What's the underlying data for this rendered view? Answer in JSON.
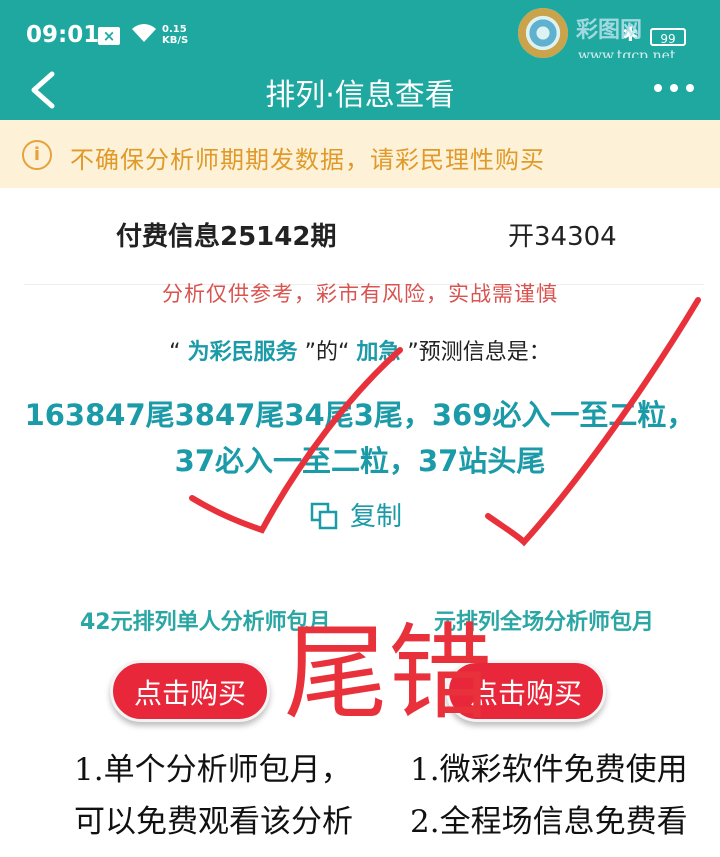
{
  "status": {
    "time": "09:01",
    "x_badge": "×",
    "speed_value": "0.15",
    "speed_unit": "KB/S",
    "battery": "99"
  },
  "watermark": {
    "title": "彩图网",
    "url": "www.tqcp.net"
  },
  "nav": {
    "title": "排列·信息查看",
    "back_icon": "chevron-left-icon",
    "more_icon": "more-dots-icon"
  },
  "notice": {
    "icon": "info-icon",
    "text": "不确保分析师期期发数据，请彩民理性购买"
  },
  "info": {
    "title": "付费信息25142期",
    "open_result": "开34304",
    "warning": "分析仅供参考，彩市有风险，实战需谨慎"
  },
  "predict": {
    "quote_open": "“",
    "source_name": "为彩民服务",
    "mid": "”的“",
    "analyst_name": "加急",
    "suffix": "”预测信息是：",
    "line1": "163847尾3847尾34尾3尾，369必入一至二粒，",
    "line2": "37必入一至二粒，37站头尾"
  },
  "copy": {
    "label": "复制",
    "icon": "copy-icon"
  },
  "plans": [
    {
      "title": "42元排列单人分析师包月",
      "button": "点击购买",
      "features": [
        "1.单个分析师包月，",
        "可以免费观看该分析"
      ]
    },
    {
      "title": "元排列全场分析师包月",
      "button": "点击购买",
      "features": [
        "1.微彩软件免费使用",
        "2.全程场信息免费看"
      ]
    }
  ],
  "handwriting": {
    "text": "尾错",
    "color": "#e8313a"
  },
  "colors": {
    "teal": "#1ea8a0",
    "accent_text": "#1b9aa8",
    "notice_bg": "#fdf2d8",
    "notice_text": "#e09a2a",
    "warning_text": "#d9534f",
    "buy_button": "#e8273b"
  }
}
